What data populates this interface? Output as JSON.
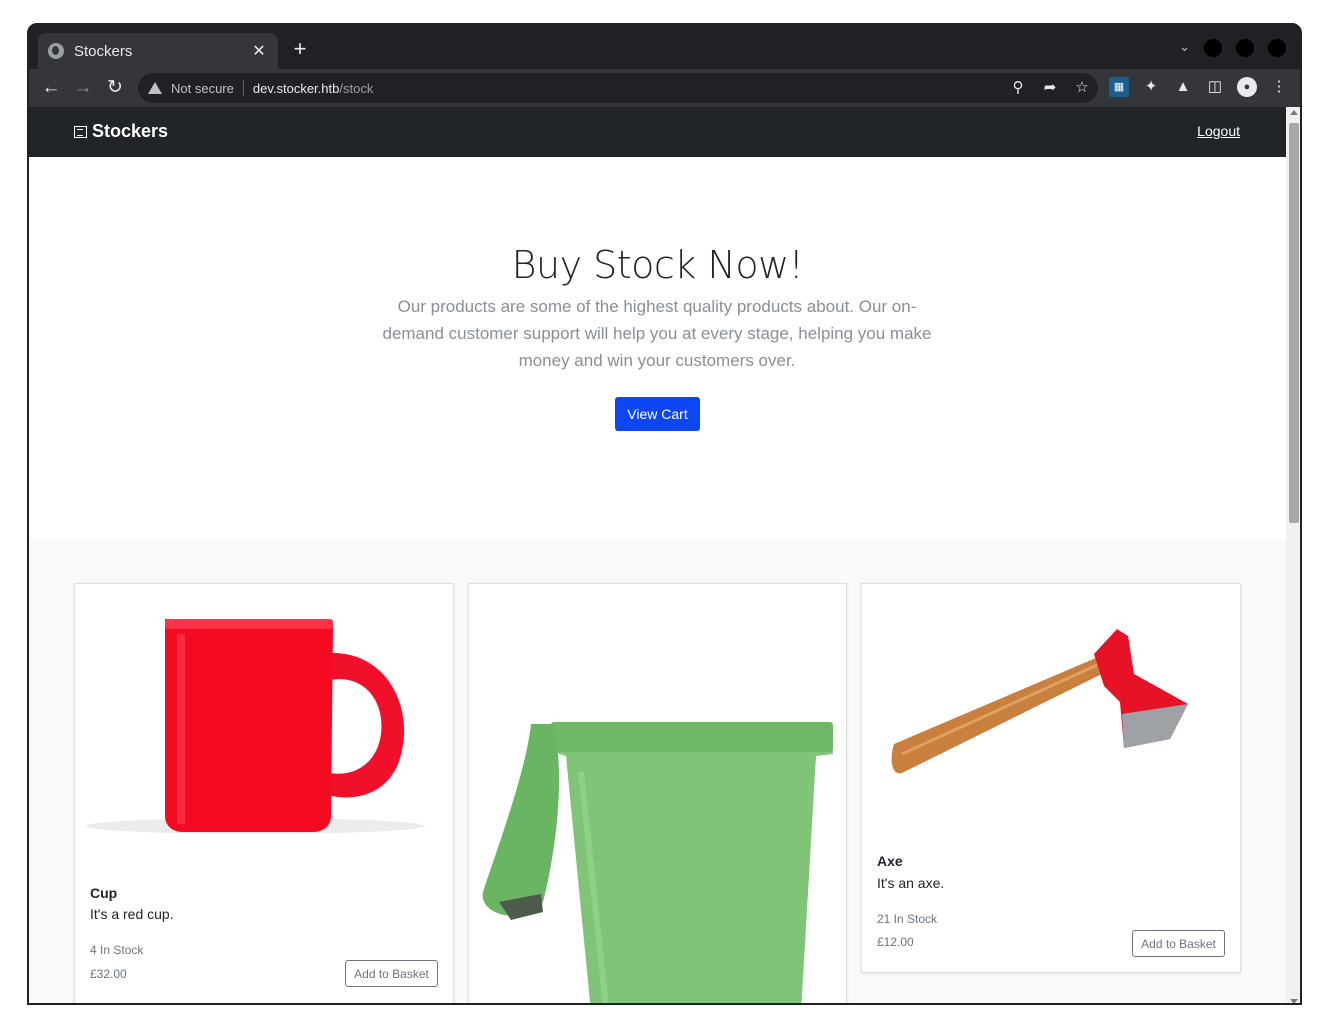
{
  "browser": {
    "tab_title": "Stockers",
    "close_glyph": "✕",
    "newtab_glyph": "+",
    "not_secure": "Not secure",
    "url_host": "dev.stocker.htb",
    "url_path": "/stock"
  },
  "site": {
    "brand": "Stockers",
    "logout": "Logout"
  },
  "hero": {
    "title": "Buy Stock Now!",
    "text": "Our products are some of the highest quality products about. Our on-demand customer support will help you at every stage, helping you make money and win your customers over.",
    "button": "View Cart"
  },
  "products": [
    {
      "name": "Cup",
      "description": "It's a red cup.",
      "stock": "4 In Stock",
      "price": "£32.00",
      "button": "Add to Basket",
      "image": "red-mug"
    },
    {
      "name": "",
      "description": "",
      "stock": "",
      "price": "",
      "button": "",
      "image": "green-bin"
    },
    {
      "name": "Axe",
      "description": "It's an axe.",
      "stock": "21 In Stock",
      "price": "£12.00",
      "button": "Add to Basket",
      "image": "axe"
    }
  ],
  "colors": {
    "navbar": "#212529",
    "primary_button": "#0d47f5",
    "section_bg": "#f8f9fa",
    "browser_chrome": "#35363a"
  },
  "icons": [
    "globe-icon",
    "close-icon",
    "plus-icon",
    "back-icon",
    "forward-icon",
    "reload-icon",
    "warning-icon",
    "zoom-icon",
    "share-icon",
    "star-icon",
    "extension-icon",
    "puzzle-icon",
    "flask-icon",
    "sidepanel-icon",
    "profile-icon",
    "menu-icon",
    "newspaper-icon"
  ]
}
